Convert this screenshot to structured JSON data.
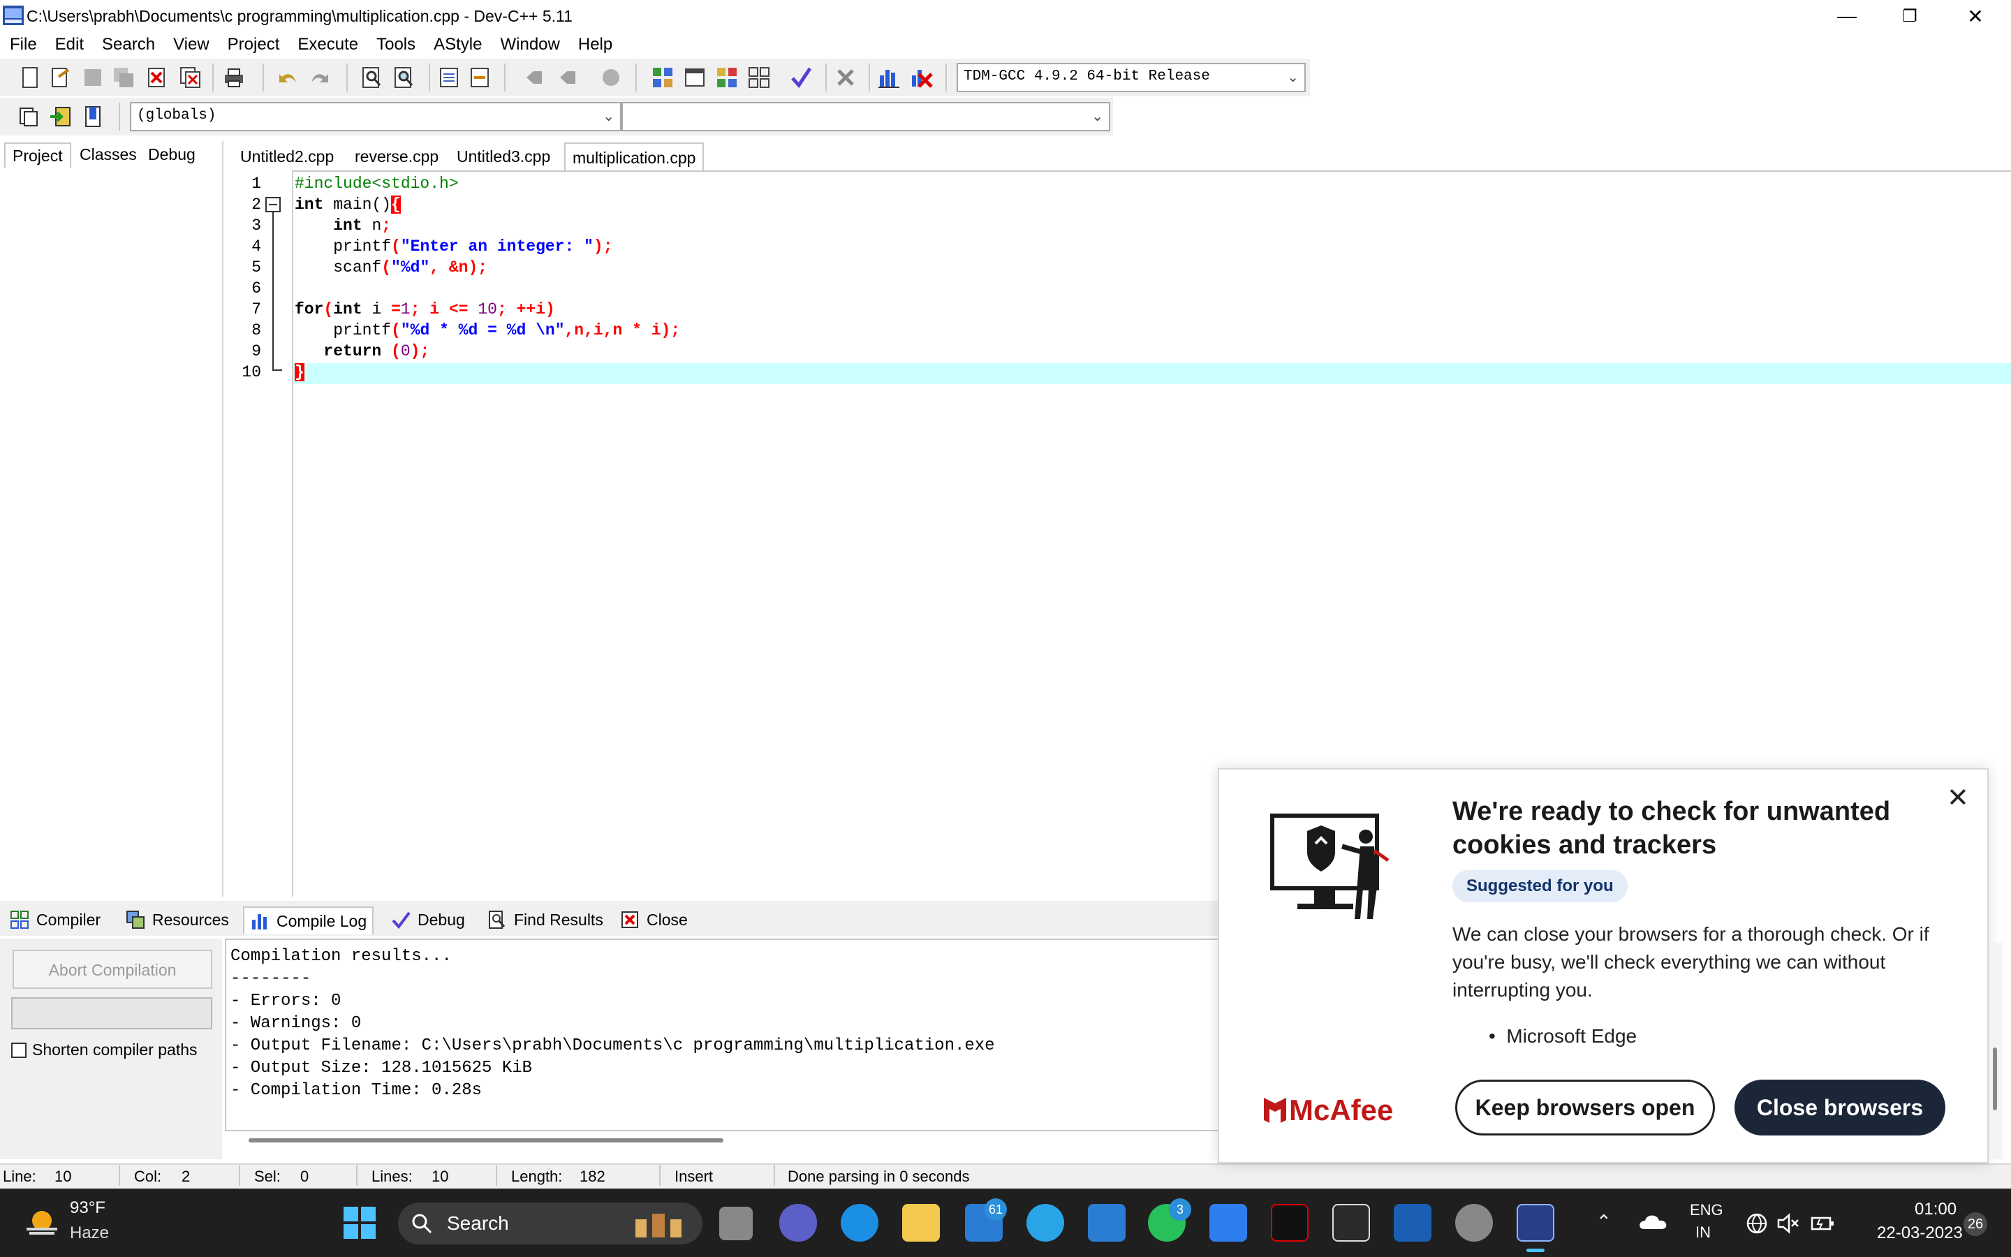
{
  "window": {
    "title": "C:\\Users\\prabh\\Documents\\c programming\\multiplication.cpp - Dev-C++ 5.11",
    "minimize": "—",
    "maximize": "❐",
    "close": "✕"
  },
  "menu": [
    "File",
    "Edit",
    "Search",
    "View",
    "Project",
    "Execute",
    "Tools",
    "AStyle",
    "Window",
    "Help"
  ],
  "toolbar": {
    "compiler_select": "TDM-GCC 4.9.2 64-bit Release",
    "scope_select": "(globals)",
    "symbol_select": ""
  },
  "left_tabs": [
    "Project",
    "Classes",
    "Debug"
  ],
  "editor_tabs": [
    "Untitled2.cpp",
    "reverse.cpp",
    "Untitled3.cpp",
    "multiplication.cpp"
  ],
  "active_editor_tab": "multiplication.cpp",
  "code": {
    "line_numbers": [
      "1",
      "2",
      "3",
      "4",
      "5",
      "6",
      "7",
      "8",
      "9",
      "10"
    ],
    "l1": "#include<stdio.h>",
    "l2_kw": "int",
    "l2_rest": " main()",
    "l2_brace": "{",
    "l3_kw": "int",
    "l3_rest": " n",
    "l3_semi": ";",
    "l4_a": "printf",
    "l4_b": "(",
    "l4_str": "\"Enter an integer: \"",
    "l4_c": ");",
    "l5_a": "scanf",
    "l5_b": "(",
    "l5_str": "\"%d\"",
    "l5_c": ", &n);",
    "l7_kw": "for",
    "l7_a": "(",
    "l7_kw2": "int",
    "l7_b": " i ",
    "l7_c": "=",
    "l7_d": "1",
    "l7_e": "; i ",
    "l7_f": "<=",
    "l7_g": " ",
    "l7_h": "10",
    "l7_i": "; ",
    "l7_j": "++",
    "l7_k": "i)",
    "l8_a": "printf",
    "l8_b": "(",
    "l8_str": "\"%d * %d = %d \\n\"",
    "l8_c": ",n,i,n ",
    "l8_d": "*",
    "l8_e": " i);",
    "l9_kw": "return",
    "l9_a": " (",
    "l9_num": "0",
    "l9_b": ");",
    "l10": "}"
  },
  "bottom_tabs": [
    "Compiler",
    "Resources",
    "Compile Log",
    "Debug",
    "Find Results",
    "Close"
  ],
  "active_bottom_tab": "Compile Log",
  "compile": {
    "abort_label": "Abort Compilation",
    "shorten_label": "Shorten compiler paths",
    "log": [
      "Compilation results...",
      "--------",
      "- Errors: 0",
      "- Warnings: 0",
      "- Output Filename: C:\\Users\\prabh\\Documents\\c programming\\multiplication.exe",
      "- Output Size: 128.1015625 KiB",
      "- Compilation Time: 0.28s"
    ]
  },
  "status": {
    "line_label": "Line:",
    "line_value": "10",
    "col_label": "Col:",
    "col_value": "2",
    "sel_label": "Sel:",
    "sel_value": "0",
    "lines_label": "Lines:",
    "lines_value": "10",
    "length_label": "Length:",
    "length_value": "182",
    "mode": "Insert",
    "message": "Done parsing in 0 seconds"
  },
  "popup": {
    "title": "We're ready to check for unwanted cookies and trackers",
    "badge": "Suggested for you",
    "body": "We can close your browsers for a thorough check. Or if you're busy, we'll check everything we can without interrupting you.",
    "bullet": "Microsoft Edge",
    "keep_button": "Keep browsers open",
    "close_button": "Close browsers",
    "brand": "McAfee",
    "close_icon": "✕"
  },
  "taskbar": {
    "weather_temp": "93°F",
    "weather_desc": "Haze",
    "search_placeholder": "Search",
    "mail_badge": "61",
    "whatsapp_badge": "3",
    "lang": "ENG",
    "region": "IN",
    "time": "01:00",
    "date": "22-03-2023",
    "notif_count": "26"
  }
}
